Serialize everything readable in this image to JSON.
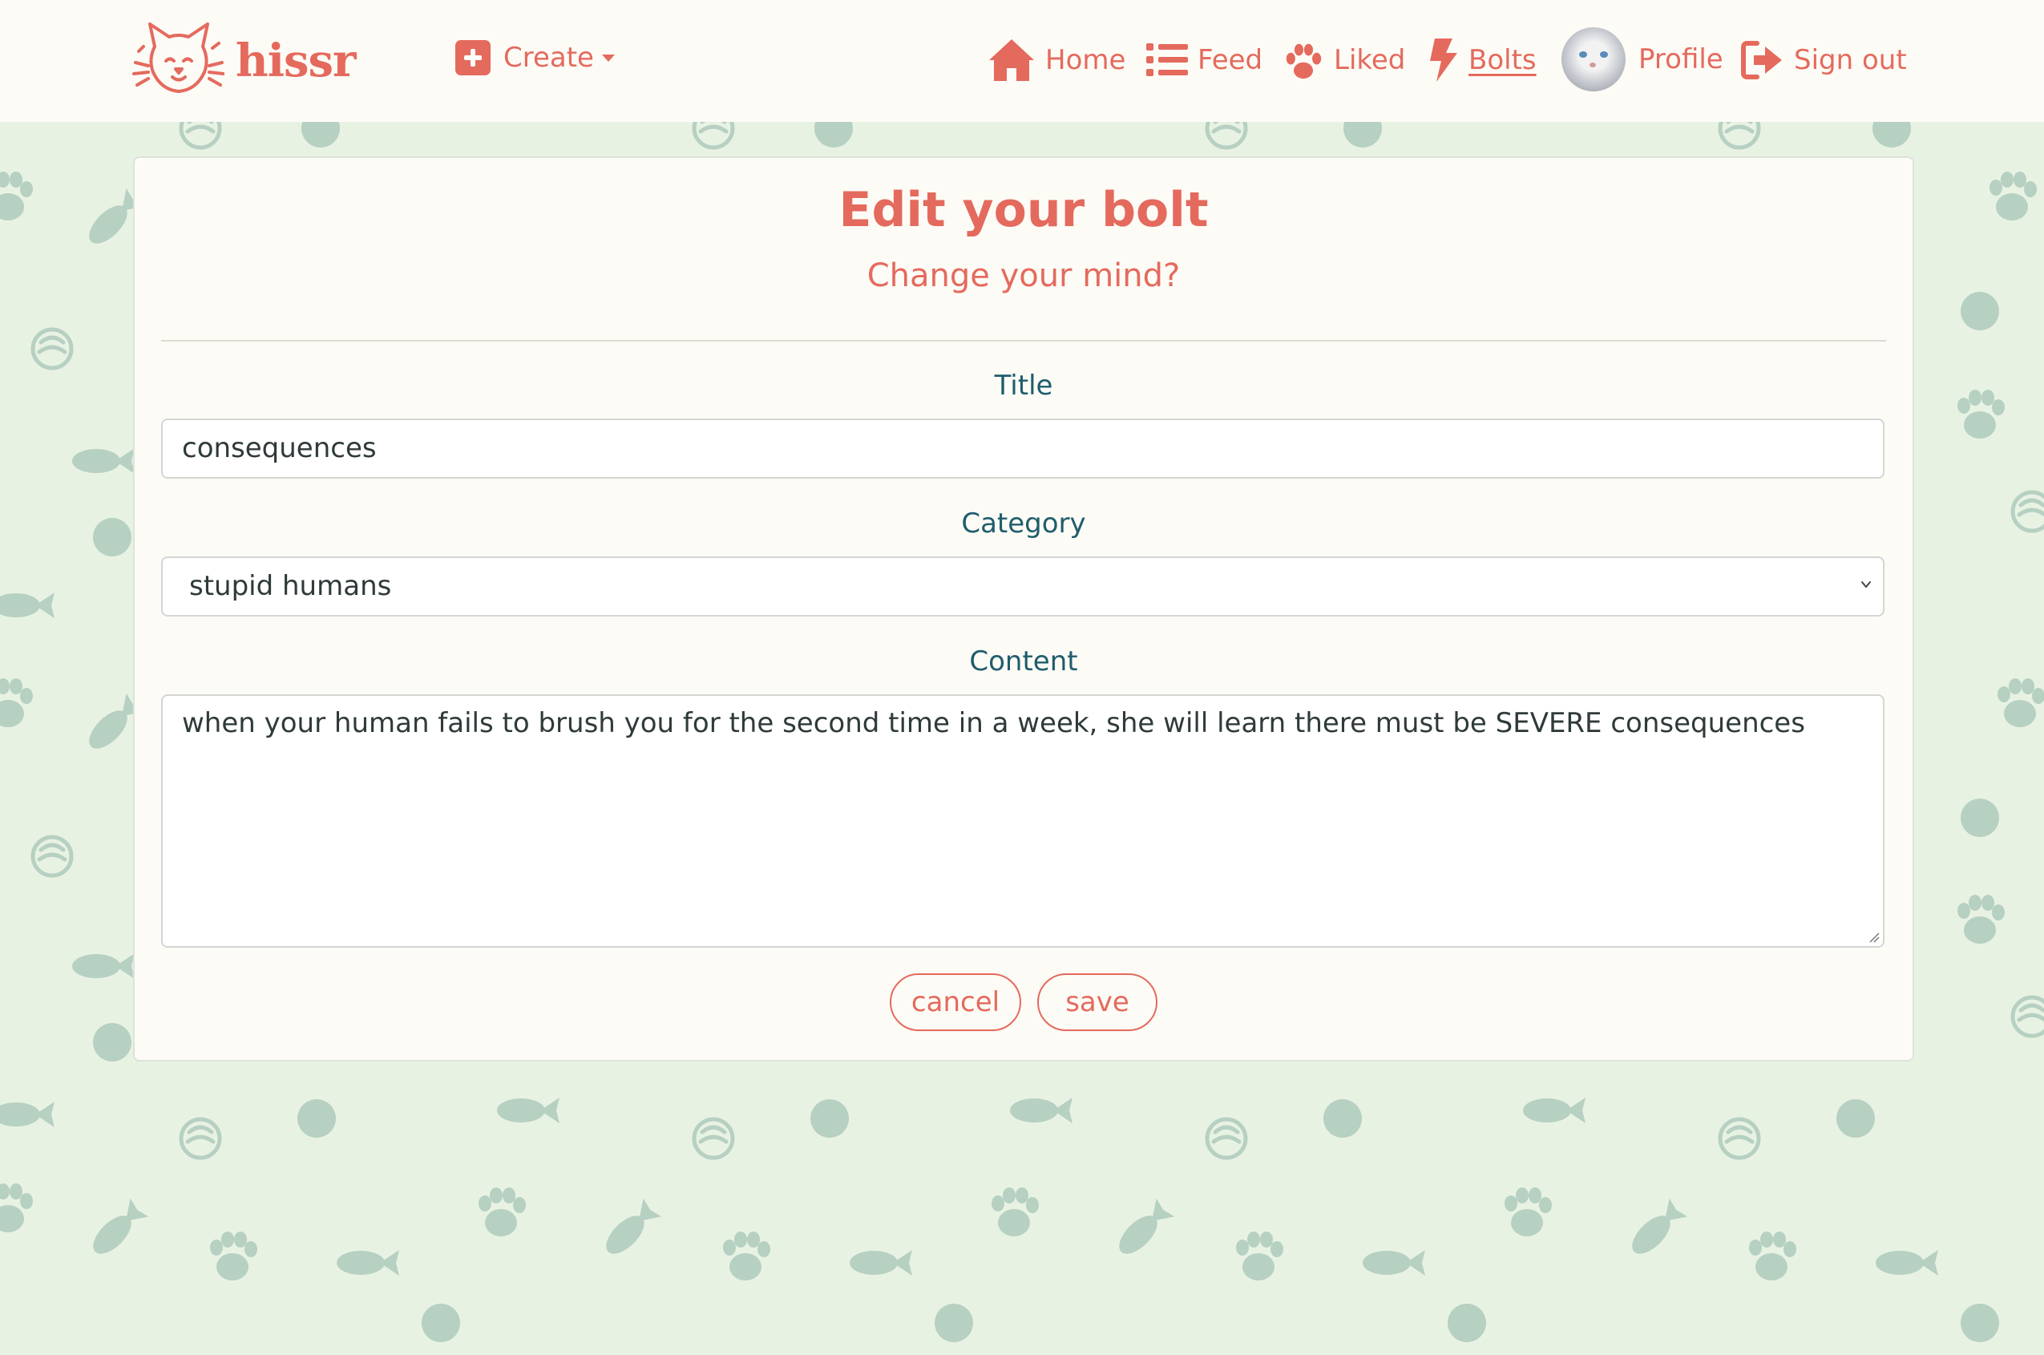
{
  "brand": {
    "name": "hissr",
    "logo_icon": "cat-face-icon"
  },
  "nav": {
    "create_label": "Create",
    "items": [
      {
        "label": "Home",
        "icon": "home-icon"
      },
      {
        "label": "Feed",
        "icon": "list-icon"
      },
      {
        "label": "Liked",
        "icon": "paw-icon"
      },
      {
        "label": "Bolts",
        "icon": "bolt-icon",
        "active": true
      },
      {
        "label": "Profile",
        "icon": "avatar"
      },
      {
        "label": "Sign out",
        "icon": "sign-out-icon"
      }
    ]
  },
  "form": {
    "title": "Edit your bolt",
    "subtitle": "Change your mind?",
    "title_label": "Title",
    "title_value": "consequences",
    "category_label": "Category",
    "category_value": "stupid humans",
    "content_label": "Content",
    "content_value": "when your human fails to brush you for the second time in a week, she will learn there must be SEVERE consequences",
    "cancel_label": "cancel",
    "save_label": "save"
  },
  "colors": {
    "accent": "#e46a5d",
    "label": "#1f5d6c",
    "background": "#e8f2e3",
    "pattern": "#b6d0c2",
    "surface": "#fdfbf6"
  }
}
